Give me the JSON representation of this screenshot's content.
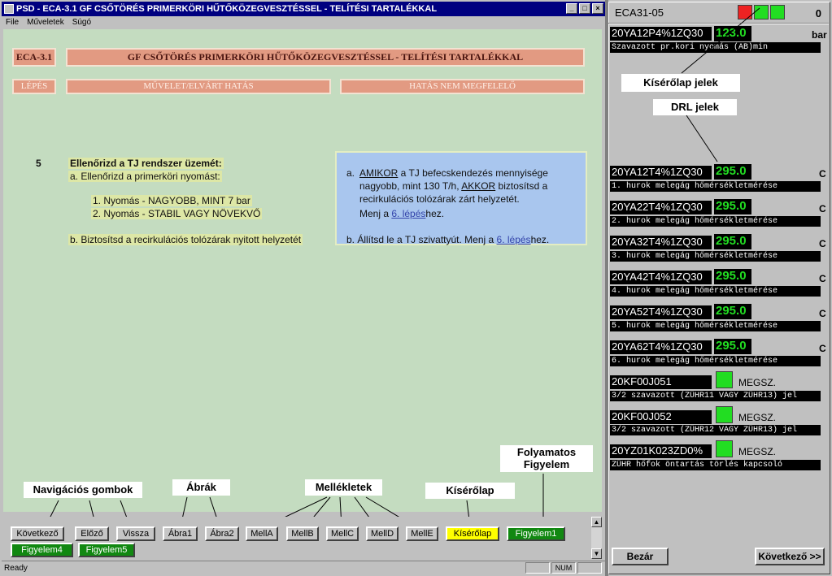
{
  "window": {
    "title": "PSD - ECA-3.1 GF CSŐTÖRÉS PRIMERKÖRI HŰTŐKÖZEGVESZTÉSSEL - TELÍTÉSI TARTALÉKKAL",
    "menu": [
      "File",
      "Műveletek",
      "Súgó"
    ]
  },
  "procedure": {
    "code": "ECA-3.1",
    "title": "GF CSŐTÖRÉS PRIMERKÖRI HŰTŐKÖZEGVESZTÉSSEL - TELÍTÉSI TARTALÉKKAL",
    "col_step": "LÉPÉS",
    "col_action": "MŰVELET/ELVÁRT HATÁS",
    "col_fail": "HATÁS NEM MEGFELELŐ"
  },
  "step": {
    "number": "5",
    "title": "Ellenőrizd a TJ rendszer üzemét:",
    "a": "a. Ellenőrizd a primerköri nyomást:",
    "a1": "1.   Nyomás - NAGYOBB, MINT 7 bar",
    "a2": "2.   Nyomás - STABIL VAGY NÖVEKVŐ",
    "b": "b. Biztosítsd a recirkulációs tolózárak nyitott helyzetét"
  },
  "fail": {
    "a_prefix": "a.",
    "a_l1_k1": "AMIKOR",
    "a_l1_rest": " a TJ befecskendezés mennyisége",
    "a_l2_pre": "nagyobb, mint 130 T/h, ",
    "a_l2_k2": "AKKOR",
    "a_l2_rest": " biztosítsd a",
    "a_l3": "recirkulációs tolózárak zárt helyzetét.",
    "a_l4_pre": "Menj a ",
    "a_l4_link": "6. lépés",
    "a_l4_post": "hez.",
    "b_pre": "b. Állítsd le a TJ szivattyút. Menj a ",
    "b_link": "6. lépés",
    "b_post": "hez."
  },
  "buttons": {
    "kovetkezo": "Következő",
    "elozo": "Előző",
    "vissza": "Vissza",
    "abra1": "Ábra1",
    "abra2": "Ábra2",
    "mella": "MellA",
    "mellb": "MellB",
    "mellc": "MellC",
    "melld": "MellD",
    "melle": "MellE",
    "kiserolap": "Kísérőlap",
    "figyelem1": "Figyelem1",
    "figyelem4": "Figyelem4",
    "figyelem5": "Figyelem5"
  },
  "callouts": {
    "nav": "Navigációs  gombok",
    "abrak": "Ábrák",
    "mellekletek": "Mellékletek",
    "kiserolap": "Kísérőlap",
    "folyamatos": "Folyamatos",
    "figyelem": "Figyelem",
    "kiserolap_jelek": "Kísérőlap jelek",
    "drl_jelek": "DRL jelek"
  },
  "status": {
    "ready": "Ready",
    "num": "NUM"
  },
  "panel": {
    "title": "ECA31-05",
    "count": "0",
    "indicators": [
      "red",
      "green",
      "green"
    ],
    "signals": [
      {
        "code": "20YA12P4%1ZQ30",
        "value": "123.0",
        "unit": "bar",
        "desc": "Szavazott pr.kori nyomás (AB)min"
      },
      {
        "code": "20YA12T4%1ZQ30",
        "value": "295.0",
        "unit": "C",
        "desc": "1. hurok melegág hőmérsékletmérése"
      },
      {
        "code": "20YA22T4%1ZQ30",
        "value": "295.0",
        "unit": "C",
        "desc": "2. hurok melegág hőmérsékletmérése"
      },
      {
        "code": "20YA32T4%1ZQ30",
        "value": "295.0",
        "unit": "C",
        "desc": "3. hurok melegág hőmérsékletmérése"
      },
      {
        "code": "20YA42T4%1ZQ30",
        "value": "295.0",
        "unit": "C",
        "desc": "4. hurok melegág hőmérsékletmérése"
      },
      {
        "code": "20YA52T4%1ZQ30",
        "value": "295.0",
        "unit": "C",
        "desc": "5. hurok melegág hőmérsékletmérése"
      },
      {
        "code": "20YA62T4%1ZQ30",
        "value": "295.0",
        "unit": "C",
        "desc": "6. hurok melegág hőmérsékletmérése"
      }
    ],
    "lamps": [
      {
        "code": "20KF00J051",
        "text": "MEGSZ.",
        "desc": "3/2 szavazott (ZÜHR11 VAGY ZÜHR13) jel"
      },
      {
        "code": "20KF00J052",
        "text": "MEGSZ.",
        "desc": "3/2 szavazott (ZÜHR12 VAGY ZÜHR13) jel"
      },
      {
        "code": "20YZ01K023ZD0%",
        "text": "MEGSZ.",
        "desc": "ZÜHR hőfok öntartás törlés kapcsoló"
      }
    ],
    "close_button": "Bezár",
    "next_button": "Következő >>"
  },
  "colors": {
    "content_bg": "#c4dcc0",
    "header_box": "#e29a82",
    "fail_box": "#a9c6ee",
    "value_green": "#22dd22",
    "titlebar": "#000080"
  }
}
